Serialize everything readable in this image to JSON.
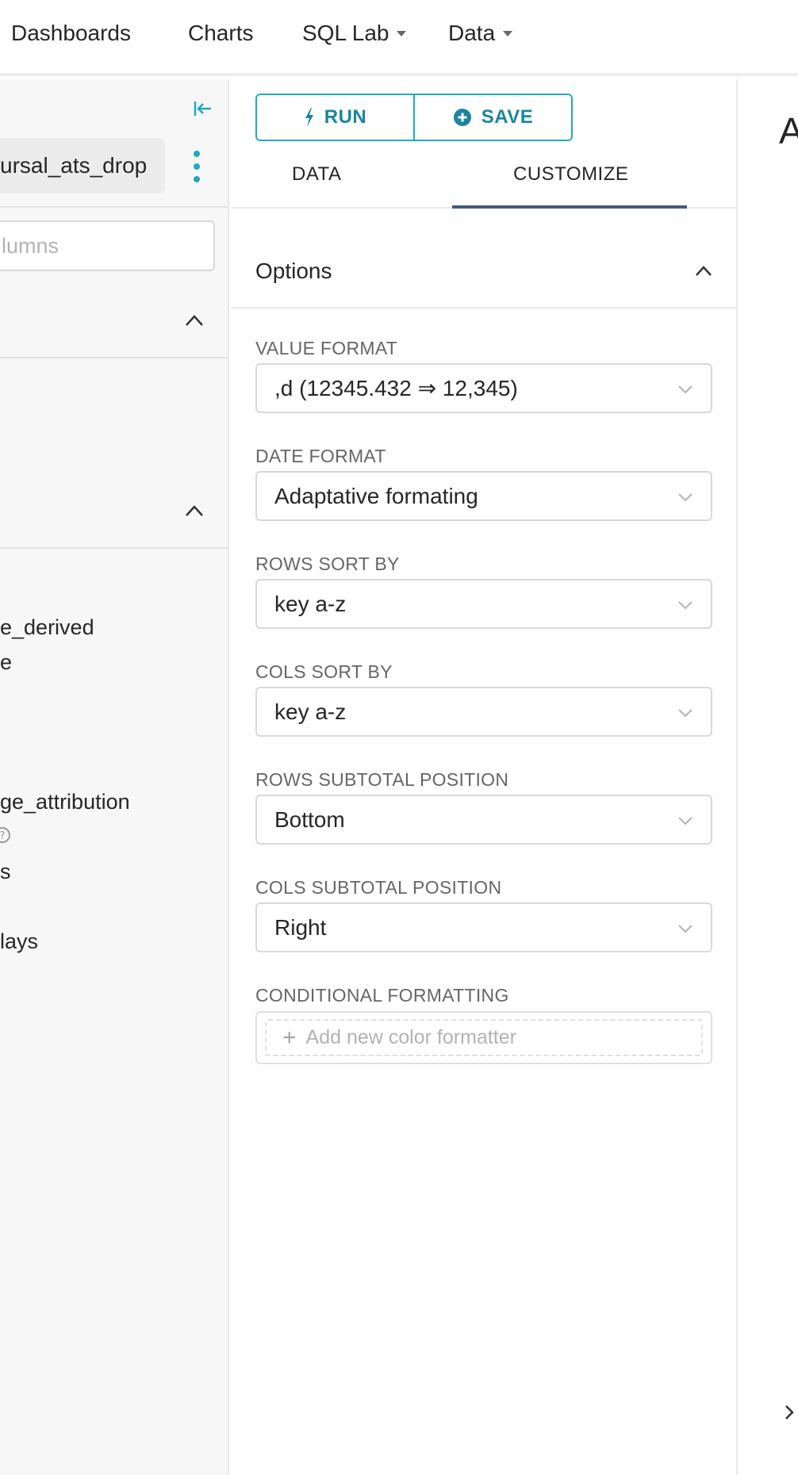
{
  "nav": {
    "items": [
      {
        "label": "Dashboards"
      },
      {
        "label": "Charts"
      },
      {
        "label": "SQL Lab"
      },
      {
        "label": "Data"
      }
    ]
  },
  "left": {
    "dataset_name": "ursal_ats_drop",
    "search_placeholder": "lumns",
    "fragments": [
      "e_derived",
      "e",
      "ge_attribution",
      "s",
      "lays"
    ]
  },
  "toolbar": {
    "run_label": "RUN",
    "save_label": "SAVE"
  },
  "tabs": [
    {
      "label": "DATA",
      "active": false
    },
    {
      "label": "CUSTOMIZE",
      "active": true
    }
  ],
  "options": {
    "title": "Options",
    "fields": [
      {
        "label": "VALUE FORMAT",
        "value": ",d (12345.432 ⇒ 12,345)"
      },
      {
        "label": "DATE FORMAT",
        "value": "Adaptative formating"
      },
      {
        "label": "ROWS SORT BY",
        "value": "key a-z"
      },
      {
        "label": "COLS SORT BY",
        "value": "key a-z"
      },
      {
        "label": "ROWS SUBTOTAL POSITION",
        "value": "Bottom"
      },
      {
        "label": "COLS SUBTOTAL POSITION",
        "value": "Right"
      }
    ],
    "conditional": {
      "label": "CONDITIONAL FORMATTING",
      "add_label": "Add new color formatter"
    }
  },
  "right": {
    "title_fragment": "A"
  },
  "colors": {
    "accent": "#20a7c9",
    "accent_text": "#1985a0",
    "tab_underline": "#455a80",
    "panel_bg": "#f7f7f7"
  }
}
